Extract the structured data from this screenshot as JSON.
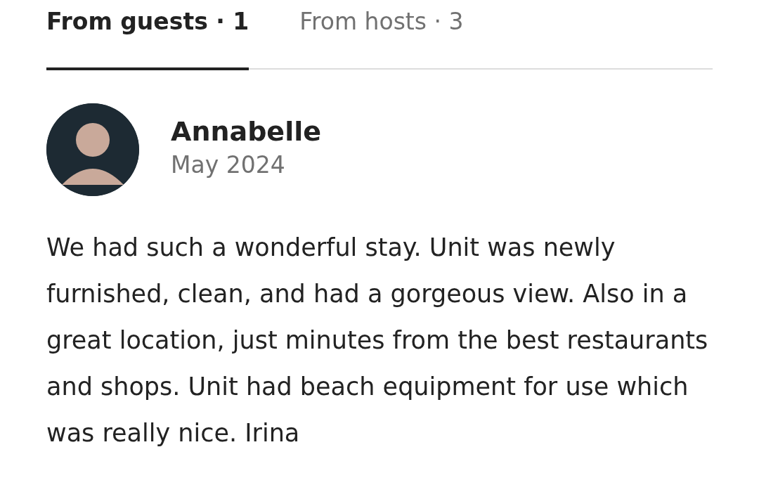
{
  "tabs": [
    {
      "label": "From guests · 1",
      "selected": true
    },
    {
      "label": "From hosts · 3",
      "selected": false
    }
  ],
  "review": {
    "name": "Annabelle",
    "date": "May 2024",
    "text": "We had such a wonderful stay. Unit was newly furnished, clean, and had a gorgeous view. Also in a great location, just minutes from the best restaurants and shops. Unit had beach equipment for use which was really nice. Irina"
  }
}
